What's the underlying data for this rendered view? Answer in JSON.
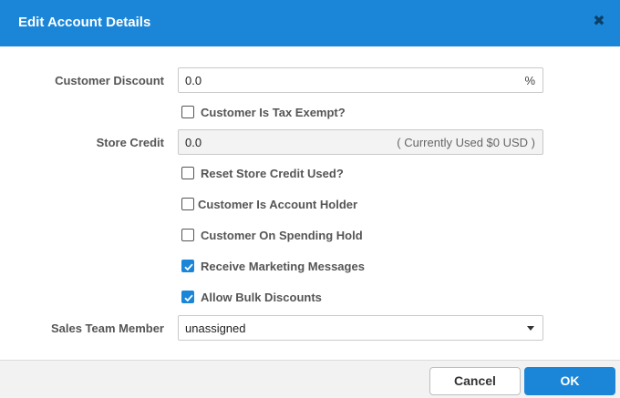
{
  "dialog": {
    "title": "Edit Account Details",
    "close_icon": "close-icon"
  },
  "form": {
    "discount": {
      "label": "Customer Discount",
      "value": "0.0",
      "suffix": "%"
    },
    "tax_exempt": {
      "label": "Customer Is Tax Exempt?",
      "checked": false
    },
    "store_credit": {
      "label": "Store Credit",
      "value": "0.0",
      "note": "( Currently Used $0 USD )"
    },
    "reset_store_credit": {
      "label": "Reset Store Credit Used?",
      "checked": false
    },
    "account_holder": {
      "label": "Customer Is Account Holder",
      "checked": false
    },
    "spending_hold": {
      "label": "Customer On Spending Hold",
      "checked": false
    },
    "marketing": {
      "label": "Receive Marketing Messages",
      "checked": true
    },
    "bulk_discounts": {
      "label": "Allow Bulk Discounts",
      "checked": true
    },
    "sales_team": {
      "label": "Sales Team Member",
      "value": "unassigned"
    }
  },
  "footer": {
    "cancel_label": "Cancel",
    "ok_label": "OK"
  },
  "colors": {
    "accent": "#1b86d8",
    "header_text": "#ffffff"
  }
}
